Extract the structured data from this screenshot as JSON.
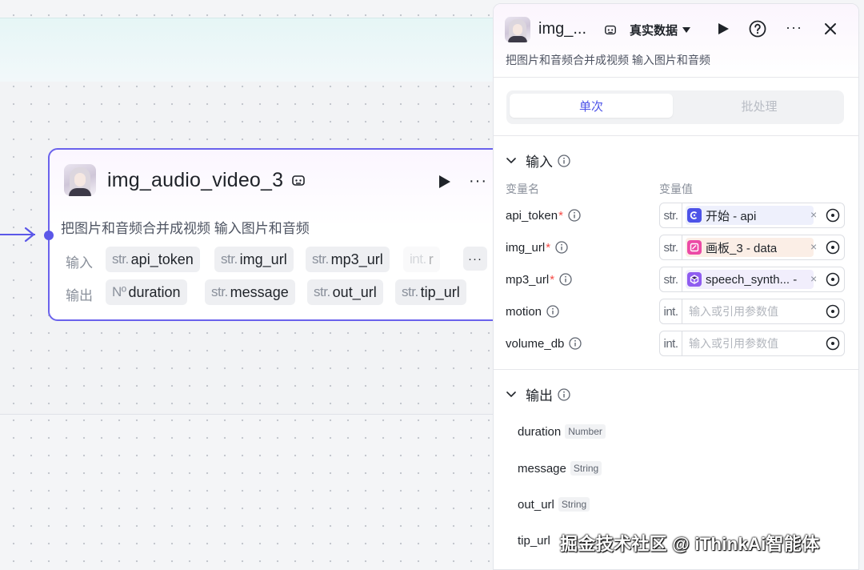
{
  "node": {
    "title": "img_audio_video_3",
    "description": "把图片和音频合并成视频 输入图片和音频",
    "input_label": "输入",
    "output_label": "输出",
    "inputs": [
      {
        "type": "str.",
        "name": "api_token"
      },
      {
        "type": "str.",
        "name": "img_url"
      },
      {
        "type": "str.",
        "name": "mp3_url"
      },
      {
        "type": "int.",
        "name": "r"
      }
    ],
    "outputs": [
      {
        "type": "Nº",
        "name": "duration"
      },
      {
        "type": "str.",
        "name": "message"
      },
      {
        "type": "str.",
        "name": "out_url"
      },
      {
        "type": "str.",
        "name": "tip_url"
      }
    ],
    "more": "···"
  },
  "panel": {
    "title": "img_...",
    "mode": "真实数据",
    "description": "把图片和音频合并成视频 输入图片和音频",
    "tabs": {
      "single": "单次",
      "batch": "批处理"
    },
    "input_section": "输入",
    "col_name": "变量名",
    "col_value": "变量值",
    "variables": [
      {
        "name": "api_token",
        "required": "*",
        "type": "str.",
        "ref": "开始 - api",
        "placeholder": ""
      },
      {
        "name": "img_url",
        "required": "*",
        "type": "str.",
        "ref": "画板_3 - data",
        "placeholder": ""
      },
      {
        "name": "mp3_url",
        "required": "*",
        "type": "str.",
        "ref": "speech_synth... -",
        "placeholder": ""
      },
      {
        "name": "motion",
        "required": "",
        "type": "int.",
        "ref": "",
        "placeholder": "输入或引用参数值"
      },
      {
        "name": "volume_db",
        "required": "",
        "type": "int.",
        "ref": "",
        "placeholder": "输入或引用参数值"
      }
    ],
    "output_section": "输出",
    "outputs": [
      {
        "name": "duration",
        "type": "Number"
      },
      {
        "name": "message",
        "type": "String"
      },
      {
        "name": "out_url",
        "type": "String"
      },
      {
        "name": "tip_url",
        "type": ""
      }
    ],
    "clear_symbol": "×",
    "more": "···"
  },
  "watermark": "掘金技术社区 @ iThinkAi智能体",
  "colors": {
    "accent": "#4d53e8",
    "node_border": "#6a62ec",
    "required": "#f54a45"
  }
}
